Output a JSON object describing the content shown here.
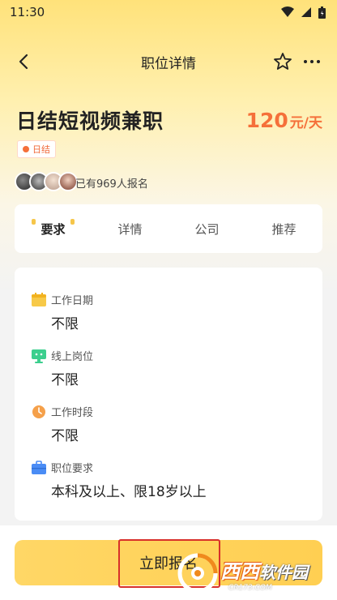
{
  "status_bar": {
    "time": "11:30"
  },
  "nav": {
    "title": "职位详情"
  },
  "job": {
    "title": "日结短视频兼职",
    "salary_amount": "120",
    "salary_unit": "元/天",
    "tag": "日结",
    "signup_text": "已有969人报名"
  },
  "tabs": [
    {
      "label": "要求",
      "active": true
    },
    {
      "label": "详情",
      "active": false
    },
    {
      "label": "公司",
      "active": false
    },
    {
      "label": "推荐",
      "active": false
    }
  ],
  "requirements": [
    {
      "icon": "calendar-icon",
      "label": "工作日期",
      "value": "不限",
      "color": "#f7c948"
    },
    {
      "icon": "monitor-icon",
      "label": "线上岗位",
      "value": "不限",
      "color": "#3ccf8e"
    },
    {
      "icon": "clock-icon",
      "label": "工作时段",
      "value": "不限",
      "color": "#f5a04a"
    },
    {
      "icon": "briefcase-icon",
      "label": "职位要求",
      "value": "本科及以上、限18岁以上",
      "color": "#4a8cf5"
    }
  ],
  "bottom": {
    "apply_label": "立即报名"
  },
  "watermark": {
    "main": "西西",
    "brand": "软件园",
    "sub": "CR173.COM"
  },
  "colors": {
    "accent": "#f5703a",
    "button": "#ffd766",
    "highlight": "#d8302a"
  }
}
